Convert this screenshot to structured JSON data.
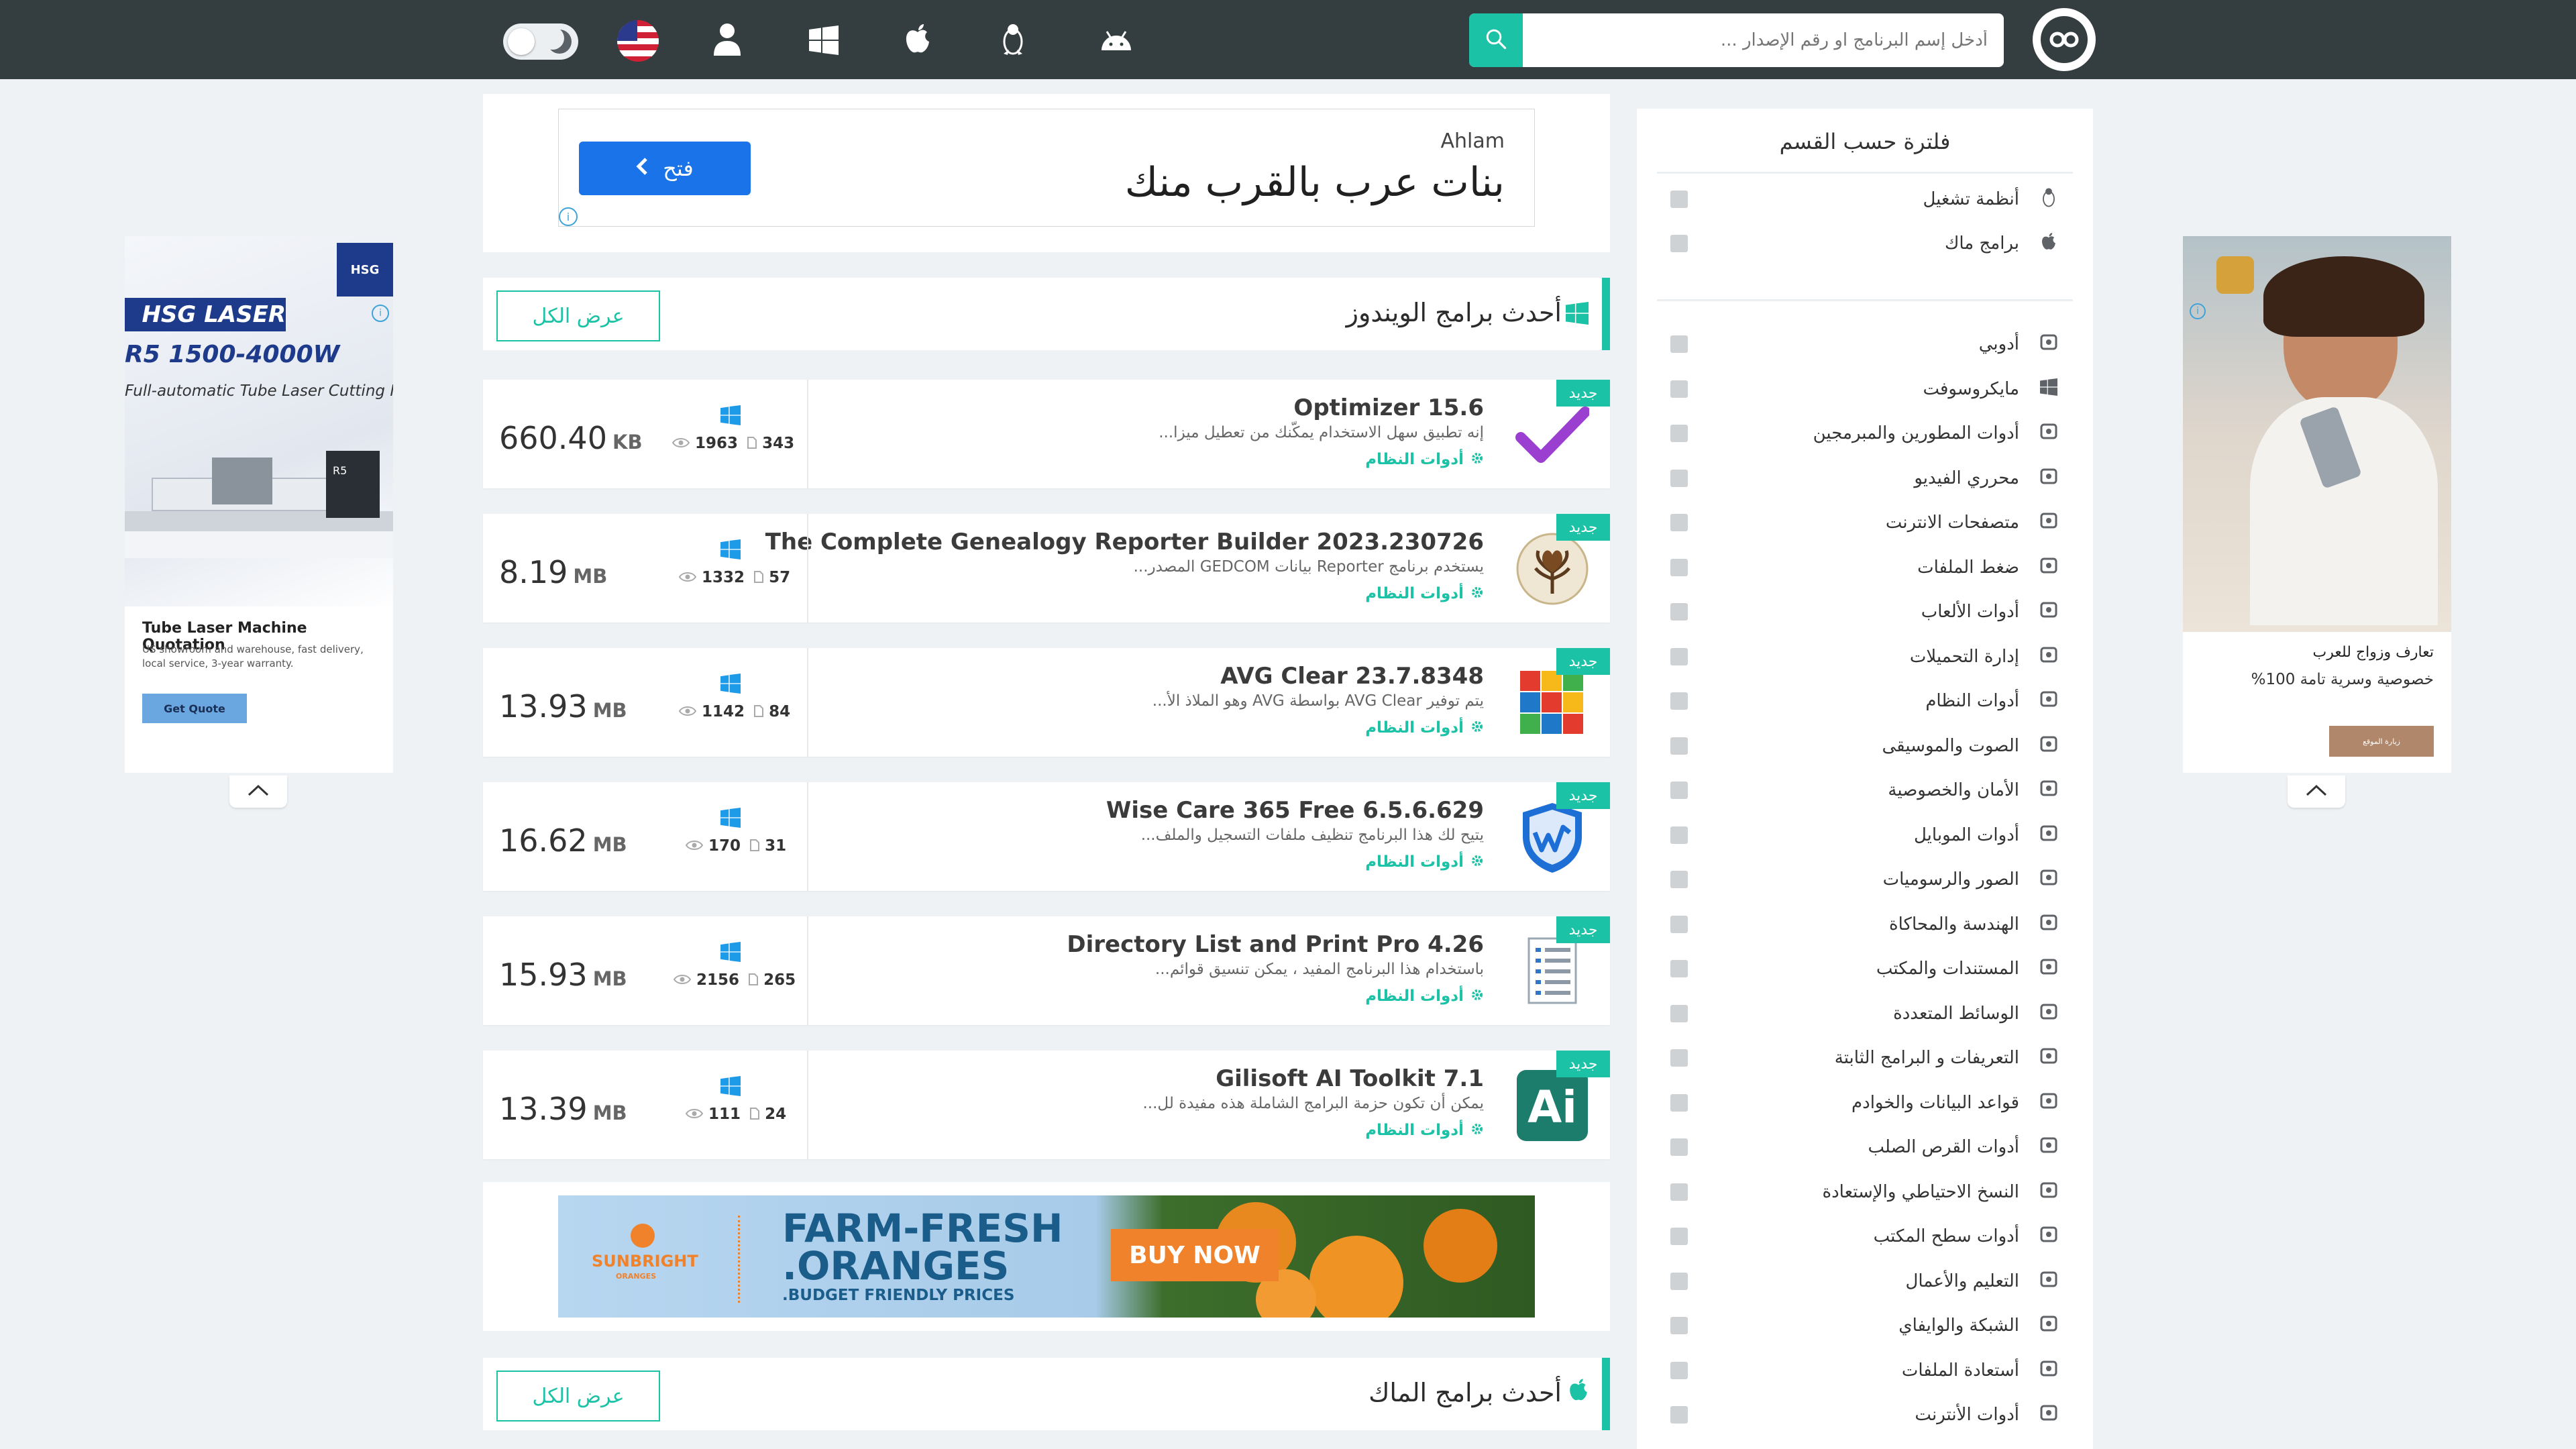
{
  "header": {
    "search_placeholder": "أدخل إسم البرنامج او رقم الإصدار ...",
    "platform_icons": [
      "android-icon",
      "linux-icon",
      "apple-icon",
      "windows-icon",
      "user-icon",
      "us-flag-icon",
      "theme-toggle"
    ],
    "accent_color": "#1bc2a5",
    "bar_color": "#343d40"
  },
  "top_ad": {
    "advertiser": "Ahlam",
    "headline": "بنات عرب بالقرب منك",
    "cta": "فتح"
  },
  "windows_section": {
    "title": "أحدث برامج الويندوز",
    "view_all": "عرض الكل",
    "new_badge": "جديد",
    "items": [
      {
        "title": "Optimizer 15.6",
        "desc": "إنه تطبيق سهل الاستخدام يمكّنك من تعطيل ميزا...",
        "category": "أدوات النظام",
        "size": "660.40",
        "unit": "KB",
        "views": "1963",
        "files": "343"
      },
      {
        "title": "The Complete Genealogy Reporter Builder 2023.230726",
        "desc": "يستخدم برنامج Reporter بيانات GEDCOM المصدر...",
        "category": "أدوات النظام",
        "size": "8.19",
        "unit": "MB",
        "views": "1332",
        "files": "57"
      },
      {
        "title": "AVG Clear 23.7.8348",
        "desc": "يتم توفير AVG Clear بواسطة AVG وهو الملاذ الأ...",
        "category": "أدوات النظام",
        "size": "13.93",
        "unit": "MB",
        "views": "1142",
        "files": "84"
      },
      {
        "title": "Wise Care 365 Free 6.5.6.629",
        "desc": "يتيح لك هذا البرنامج تنظيف ملفات التسجيل والملف...",
        "category": "أدوات النظام",
        "size": "16.62",
        "unit": "MB",
        "views": "170",
        "files": "31"
      },
      {
        "title": "Directory List and Print Pro 4.26",
        "desc": "باستخدام هذا البرنامج المفيد ، يمكن تنسيق قوائم...",
        "category": "أدوات النظام",
        "size": "15.93",
        "unit": "MB",
        "views": "2156",
        "files": "265"
      },
      {
        "title": "Gilisoft AI Toolkit 7.1",
        "desc": "يمكن أن تكون حزمة البرامج الشاملة هذه مفيدة لل...",
        "category": "أدوات النظام",
        "size": "13.39",
        "unit": "MB",
        "views": "111",
        "files": "24"
      }
    ]
  },
  "mid_ad": {
    "brand": "SUNBRIGHT",
    "brand_sub": "ORANGES",
    "headline_1": "FARM-FRESH",
    "headline_2": "ORANGES.",
    "tagline": "BUDGET FRIENDLY PRICES.",
    "cta": "BUY NOW"
  },
  "mac_section": {
    "title": "أحدث برامج الماك",
    "view_all": "عرض الكل"
  },
  "sidebar": {
    "title": "فلترة حسب القسم",
    "top_items": [
      {
        "label": "أنظمة تشغيل",
        "icon": "linux-icon"
      },
      {
        "label": "برامج ماك",
        "icon": "apple-icon"
      }
    ],
    "items": [
      {
        "label": "أدوبي",
        "icon": "palette-icon"
      },
      {
        "label": "مايكروسوفت",
        "icon": "windows-icon"
      },
      {
        "label": "أدوات المطورين والمبرمجين",
        "icon": "code-icon"
      },
      {
        "label": "محرري الفيديو",
        "icon": "video-editor-icon"
      },
      {
        "label": "متصفحات الانترنت",
        "icon": "browser-icon"
      },
      {
        "label": "ضغط الملفات",
        "icon": "archive-icon"
      },
      {
        "label": "أدوات الألعاب",
        "icon": "gamepad-icon"
      },
      {
        "label": "إدارة التحميلات",
        "icon": "download-icon"
      },
      {
        "label": "أدوات النظام",
        "icon": "gear-icon"
      },
      {
        "label": "الصوت والموسيقى",
        "icon": "music-icon"
      },
      {
        "label": "الأمان والخصوصية",
        "icon": "shield-icon"
      },
      {
        "label": "أدوات الموبايل",
        "icon": "mobile-icon"
      },
      {
        "label": "الصور والرسوميات",
        "icon": "image-icon"
      },
      {
        "label": "الهندسة والمحاكاة",
        "icon": "tools-icon"
      },
      {
        "label": "المستندات والمكتب",
        "icon": "document-icon"
      },
      {
        "label": "الوسائط المتعددة",
        "icon": "media-icon"
      },
      {
        "label": "التعريفات و البرامج الثابتة",
        "icon": "chip-icon"
      },
      {
        "label": "قواعد البيانات والخوادم",
        "icon": "server-icon"
      },
      {
        "label": "أدوات القرص الصلب",
        "icon": "disk-icon"
      },
      {
        "label": "النسخ الاحتياطي والإستعادة",
        "icon": "backup-icon"
      },
      {
        "label": "أدوات سطح المكتب",
        "icon": "desktop-icon"
      },
      {
        "label": "التعليم والأعمال",
        "icon": "education-icon"
      },
      {
        "label": "الشبكة والوايفاي",
        "icon": "wifi-icon"
      },
      {
        "label": "أستعادة الملفات",
        "icon": "folder-plus-icon"
      },
      {
        "label": "أدوات الأنترنت",
        "icon": "internet-icon"
      }
    ]
  },
  "left_ad": {
    "brand": "HSG",
    "headline": "HSG LASER",
    "model": "R5 1500-4000W",
    "subtitle": "Full-automatic Tube Laser Cutting M",
    "machine_label": "R5",
    "title": "Tube Laser Machine Quotation",
    "body": "US showroom and warehouse, fast delivery, local service, 3-year warranty.",
    "cta": "Get Quote"
  },
  "right_ad": {
    "title": "تعارف وزواج للعرب",
    "body": "خصوصية وسرية تامة 100%",
    "cta": "زيارة الموقع"
  }
}
